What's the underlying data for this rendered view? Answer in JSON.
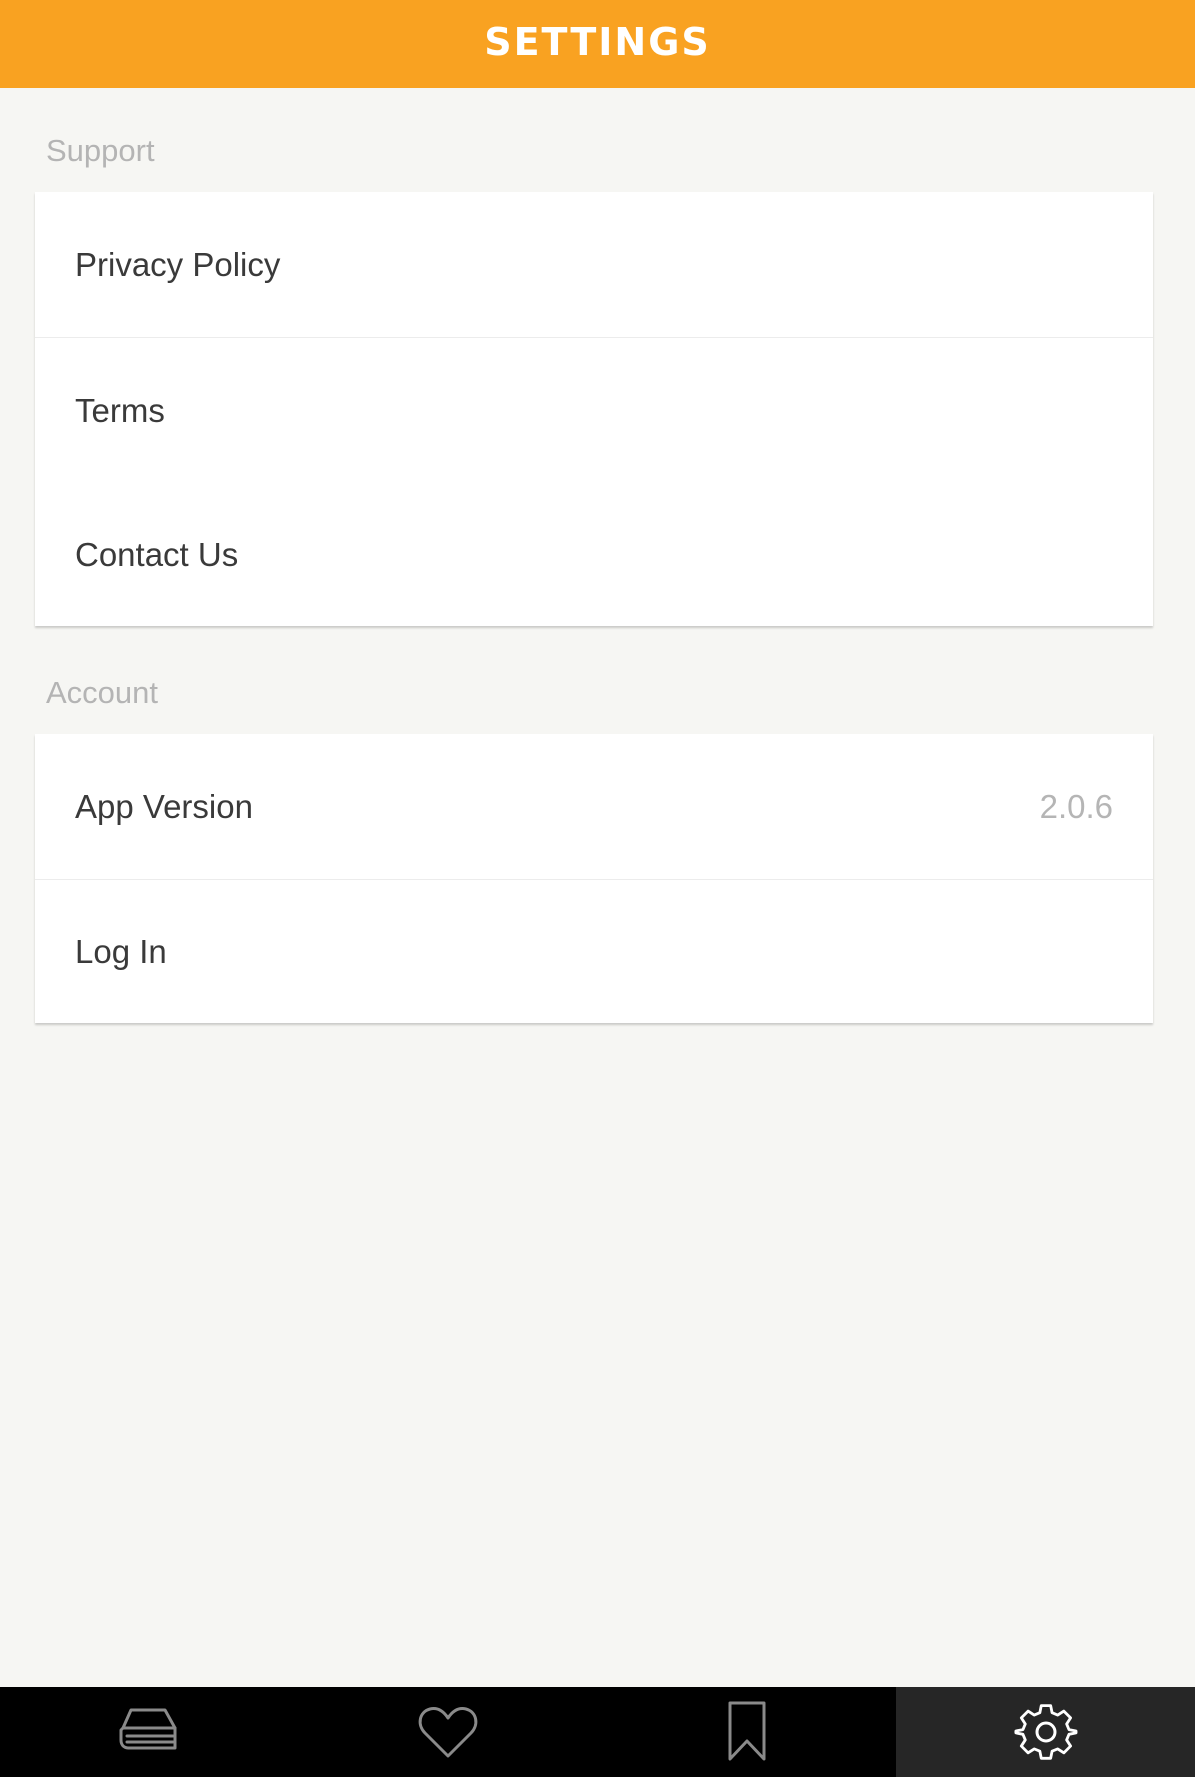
{
  "header": {
    "title": "SETTINGS"
  },
  "sections": {
    "support": {
      "label": "Support",
      "items": [
        {
          "label": "Privacy Policy"
        },
        {
          "label": "Terms"
        },
        {
          "label": "Contact Us"
        }
      ]
    },
    "account": {
      "label": "Account",
      "items": [
        {
          "label": "App Version",
          "value": "2.0.6"
        },
        {
          "label": "Log In"
        }
      ]
    }
  },
  "bottom_nav": {
    "tabs": [
      {
        "icon": "book-icon",
        "active": false
      },
      {
        "icon": "heart-icon",
        "active": false
      },
      {
        "icon": "bookmark-icon",
        "active": false
      },
      {
        "icon": "gear-icon",
        "active": true
      }
    ]
  },
  "colors": {
    "accent": "#f9a221",
    "background": "#f6f6f3",
    "bottom_bar": "#000000",
    "active_tab": "#262626"
  }
}
